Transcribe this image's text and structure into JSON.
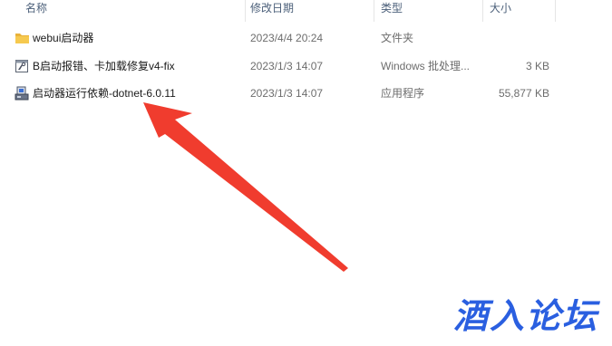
{
  "columns": {
    "name": "名称",
    "date": "修改日期",
    "type": "类型",
    "size": "大小"
  },
  "files": [
    {
      "icon": "folder-icon",
      "name": "webui启动器",
      "date": "2023/4/4 20:24",
      "type": "文件夹",
      "size": ""
    },
    {
      "icon": "batch-file-icon",
      "name": "B启动报错、卡加载修复v4-fix",
      "date": "2023/1/3 14:07",
      "type": "Windows 批处理...",
      "size": "3 KB"
    },
    {
      "icon": "installer-icon",
      "name": "启动器运行依赖-dotnet-6.0.11",
      "date": "2023/1/3 14:07",
      "type": "应用程序",
      "size": "55,877 KB"
    }
  ],
  "watermark": "酒入论坛",
  "colors": {
    "arrow": "#f03c2e",
    "watermark": "#2a5fe0",
    "folder": "#f3c34d"
  }
}
